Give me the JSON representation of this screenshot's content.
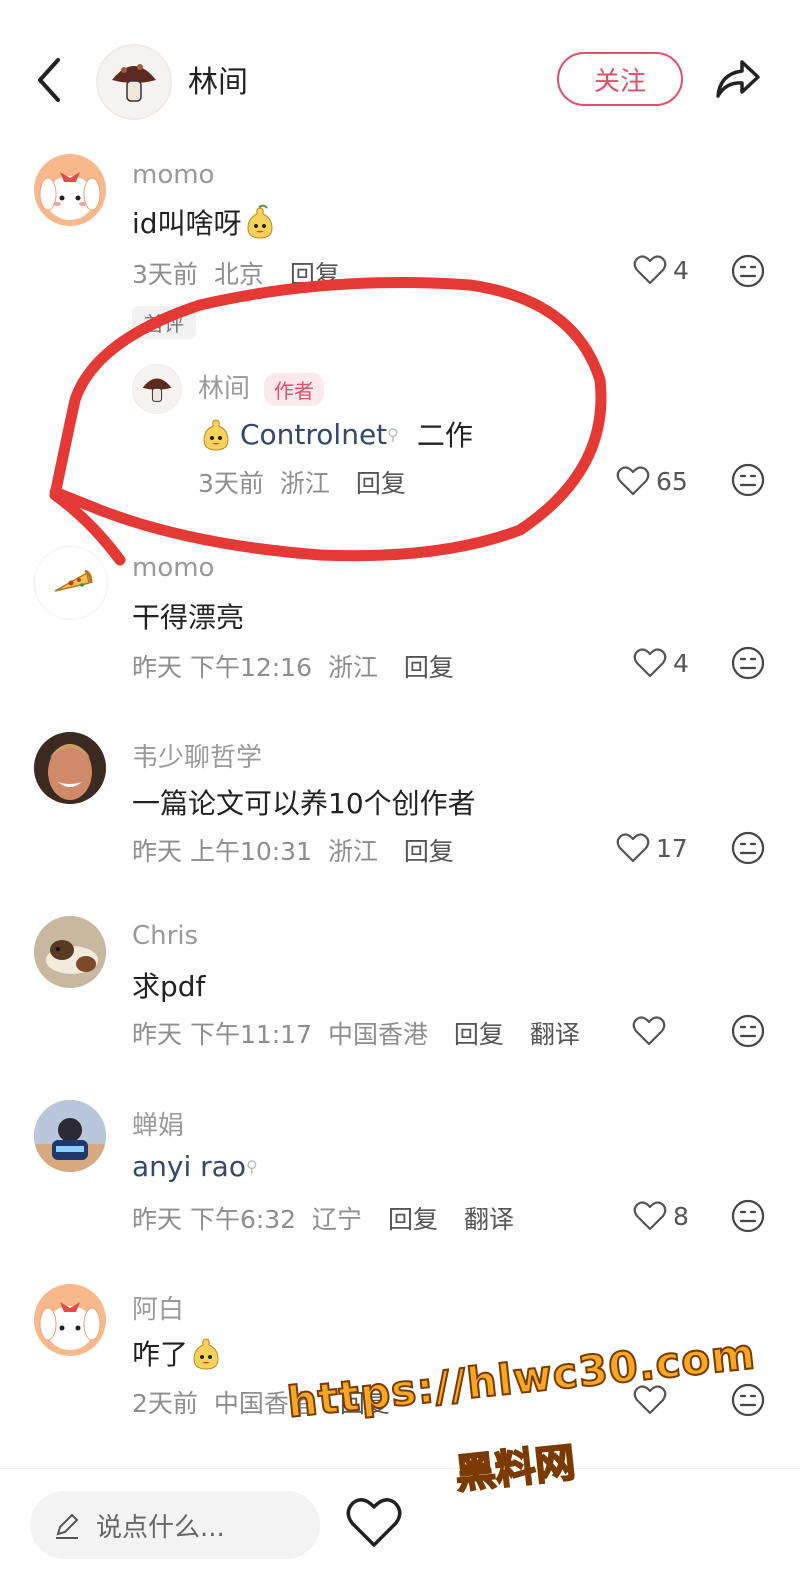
{
  "header": {
    "author_name": "林间",
    "follow_label": "关注"
  },
  "comments": [
    {
      "username": "momo",
      "text": "id叫啥呀",
      "emoji": "pear-face-emoji",
      "time": "3天前",
      "location": "北京",
      "reply_label": "回复",
      "likes": "4",
      "badge": "首评"
    },
    {
      "username": "林间",
      "author_badge": "作者",
      "mention": "Controlnet",
      "text_after": "二作",
      "time": "3天前",
      "location": "浙江",
      "reply_label": "回复",
      "likes": "65"
    },
    {
      "username": "momo",
      "text": "干得漂亮",
      "time": "昨天 下午12:16",
      "location": "浙江",
      "reply_label": "回复",
      "likes": "4"
    },
    {
      "username": "韦少聊哲学",
      "text": "一篇论文可以养10个创作者",
      "time": "昨天 上午10:31",
      "location": "浙江",
      "reply_label": "回复",
      "likes": "17"
    },
    {
      "username": "Chris",
      "text": "求pdf",
      "time": "昨天 下午11:17",
      "location": "中国香港",
      "reply_label": "回复",
      "translate_label": "翻译",
      "likes": ""
    },
    {
      "username": "蝉娟",
      "mention": "anyi rao",
      "time": "昨天 下午6:32",
      "location": "辽宁",
      "reply_label": "回复",
      "translate_label": "翻译",
      "likes": "8"
    },
    {
      "username": "阿白",
      "text": "咋了",
      "time": "2天前",
      "location": "中国香港",
      "reply_label": "回复",
      "likes": ""
    }
  ],
  "bottom_bar": {
    "input_placeholder": "说点什么..."
  },
  "watermark": {
    "line1": "https://hlwc30.com",
    "line2": "黑料网"
  },
  "colors": {
    "accent": "#e3506a",
    "annotation_red": "#e53935",
    "watermark_fill": "#f6a825"
  }
}
